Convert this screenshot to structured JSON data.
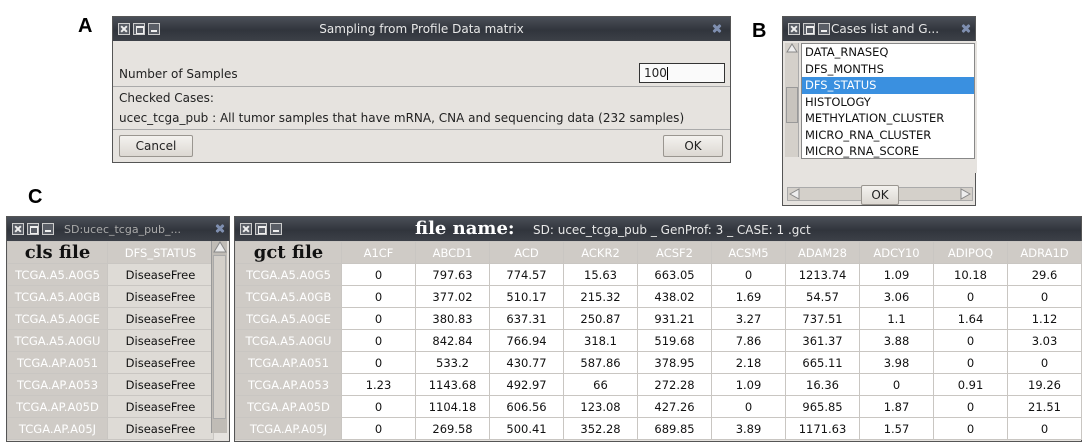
{
  "panel_labels": {
    "a": "A",
    "b": "B",
    "c": "C"
  },
  "panelA": {
    "title": "Sampling from Profile Data matrix",
    "num_samples_label": "Number of Samples",
    "num_samples_value": "100",
    "checked_cases_label": "Checked Cases:",
    "case_description": "ucec_tcga_pub :  All tumor samples that have mRNA, CNA and sequencing data (232 samples)",
    "cancel_label": "Cancel",
    "ok_label": "OK"
  },
  "panelB": {
    "title": "Cases list and G...",
    "items": [
      "DATA_RNASEQ",
      "DFS_MONTHS",
      "DFS_STATUS",
      "HISTOLOGY",
      "METHYLATION_CLUSTER",
      "MICRO_RNA_CLUSTER",
      "MICRO_RNA_SCORE"
    ],
    "selected_index": 2,
    "ok_label": "OK"
  },
  "cls": {
    "title": "SD:ucec_tcga_pub_...",
    "overlay_label": "cls file",
    "column_header": "DFS_STATUS",
    "rows": [
      [
        "TCGA.A5.A0G5",
        "DiseaseFree"
      ],
      [
        "TCGA.A5.A0GB",
        "DiseaseFree"
      ],
      [
        "TCGA.A5.A0GE",
        "DiseaseFree"
      ],
      [
        "TCGA.A5.A0GU",
        "DiseaseFree"
      ],
      [
        "TCGA.AP.A051",
        "DiseaseFree"
      ],
      [
        "TCGA.AP.A053",
        "DiseaseFree"
      ],
      [
        "TCGA.AP.A05D",
        "DiseaseFree"
      ],
      [
        "TCGA.AP.A05J",
        "DiseaseFree"
      ]
    ]
  },
  "gct": {
    "file_name_label": "file name:",
    "title": "SD: ucec_tcga_pub _ GenProf: 3 _ CASE: 1 .gct",
    "overlay_label": "gct file",
    "columns": [
      "A1CF",
      "ABCD1",
      "ACD",
      "ACKR2",
      "ACSF2",
      "ACSM5",
      "ADAM28",
      "ADCY10",
      "ADIPOQ",
      "ADRA1D"
    ],
    "rows": [
      {
        "id": "TCGA.A5.A0G5",
        "values": [
          "0",
          "797.63",
          "774.57",
          "15.63",
          "663.05",
          "0",
          "1213.74",
          "1.09",
          "10.18",
          "29.6"
        ]
      },
      {
        "id": "TCGA.A5.A0GB",
        "values": [
          "0",
          "377.02",
          "510.17",
          "215.32",
          "438.02",
          "1.69",
          "54.57",
          "3.06",
          "0",
          "0"
        ]
      },
      {
        "id": "TCGA.A5.A0GE",
        "values": [
          "0",
          "380.83",
          "637.31",
          "250.87",
          "931.21",
          "3.27",
          "737.51",
          "1.1",
          "1.64",
          "1.12"
        ]
      },
      {
        "id": "TCGA.A5.A0GU",
        "values": [
          "0",
          "842.84",
          "766.94",
          "318.1",
          "519.68",
          "7.86",
          "361.37",
          "3.88",
          "0",
          "3.03"
        ]
      },
      {
        "id": "TCGA.AP.A051",
        "values": [
          "0",
          "533.2",
          "430.77",
          "587.86",
          "378.95",
          "2.18",
          "665.11",
          "3.98",
          "0",
          "0"
        ]
      },
      {
        "id": "TCGA.AP.A053",
        "values": [
          "1.23",
          "1143.68",
          "492.97",
          "66",
          "272.28",
          "1.09",
          "16.36",
          "0",
          "0.91",
          "19.26"
        ]
      },
      {
        "id": "TCGA.AP.A05D",
        "values": [
          "0",
          "1104.18",
          "606.56",
          "123.08",
          "427.26",
          "0",
          "965.85",
          "1.87",
          "0",
          "21.51"
        ]
      },
      {
        "id": "TCGA.AP.A05J",
        "values": [
          "0",
          "269.58",
          "500.41",
          "352.28",
          "689.85",
          "3.89",
          "1171.63",
          "1.57",
          "0",
          "0"
        ]
      }
    ]
  }
}
